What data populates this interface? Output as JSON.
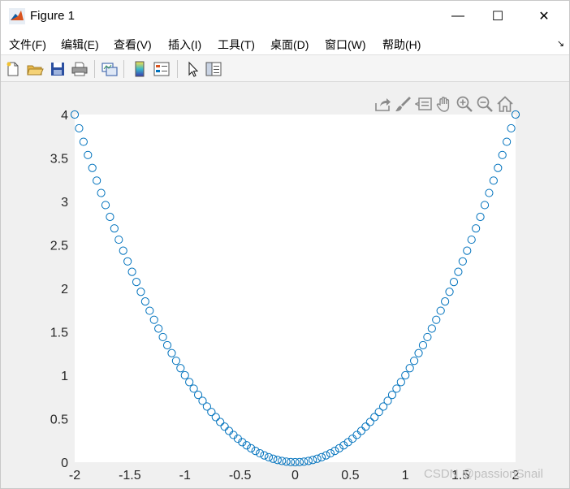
{
  "window": {
    "title": "Figure 1",
    "minimize_glyph": "—",
    "maximize_glyph": "☐",
    "close_glyph": "✕"
  },
  "menu": {
    "items": [
      {
        "label": "文件(F)"
      },
      {
        "label": "编辑(E)"
      },
      {
        "label": "查看(V)"
      },
      {
        "label": "插入(I)"
      },
      {
        "label": "工具(T)"
      },
      {
        "label": "桌面(D)"
      },
      {
        "label": "窗口(W)"
      },
      {
        "label": "帮助(H)"
      }
    ],
    "overflow_glyph": "↘"
  },
  "toolbar": {
    "icons": [
      "new-file-icon",
      "open-folder-icon",
      "save-icon",
      "print-icon",
      "link-plot-icon",
      "colorbar-icon",
      "legend-icon",
      "pointer-icon",
      "property-editor-icon"
    ]
  },
  "axes_toolbar": {
    "icons": [
      "export-icon",
      "brush-icon",
      "data-tips-icon",
      "pan-icon",
      "zoom-in-icon",
      "zoom-out-icon",
      "home-icon"
    ]
  },
  "watermark": "CSDN @passionSnail",
  "colors": {
    "marker": "#0072bd",
    "axes_bg": "#ffffff",
    "figure_bg": "#f0f0f0"
  },
  "chart_data": {
    "type": "scatter",
    "marker": "circle-open",
    "xlim": [
      -2,
      2
    ],
    "ylim": [
      0,
      4
    ],
    "x_ticks": [
      -2,
      -1.5,
      -1,
      -0.5,
      0,
      0.5,
      1,
      1.5,
      2
    ],
    "x_tick_labels": [
      "-2",
      "-1.5",
      "-1",
      "-0.5",
      "0",
      "0.5",
      "1",
      "1.5",
      "2"
    ],
    "y_ticks": [
      0,
      0.5,
      1,
      1.5,
      2,
      2.5,
      3,
      3.5,
      4
    ],
    "y_tick_labels": [
      "0",
      "0.5",
      "1",
      "1.5",
      "2",
      "2.5",
      "3",
      "3.5",
      "4"
    ],
    "series": [
      {
        "x": [
          -2,
          -1.96,
          -1.92,
          -1.88,
          -1.84,
          -1.8,
          -1.76,
          -1.72,
          -1.68,
          -1.64,
          -1.6,
          -1.56,
          -1.52,
          -1.48,
          -1.44,
          -1.4,
          -1.36,
          -1.32,
          -1.28,
          -1.24,
          -1.2,
          -1.16,
          -1.12,
          -1.08,
          -1.04,
          -1,
          -0.96,
          -0.92,
          -0.88,
          -0.84,
          -0.8,
          -0.76,
          -0.72,
          -0.68,
          -0.64,
          -0.6,
          -0.56,
          -0.52,
          -0.48,
          -0.44,
          -0.4,
          -0.36,
          -0.32,
          -0.28,
          -0.24,
          -0.2,
          -0.16,
          -0.12,
          -0.08,
          -0.04,
          0,
          0.04,
          0.08,
          0.12,
          0.16,
          0.2,
          0.24,
          0.28,
          0.32,
          0.36,
          0.4,
          0.44,
          0.48,
          0.52,
          0.56,
          0.6,
          0.64,
          0.68,
          0.72,
          0.76,
          0.8,
          0.84,
          0.88,
          0.92,
          0.96,
          1,
          1.04,
          1.08,
          1.12,
          1.16,
          1.2,
          1.24,
          1.28,
          1.32,
          1.36,
          1.4,
          1.44,
          1.48,
          1.52,
          1.56,
          1.6,
          1.64,
          1.68,
          1.72,
          1.76,
          1.8,
          1.84,
          1.88,
          1.92,
          1.96,
          2
        ],
        "y": [
          4,
          3.8416,
          3.6864,
          3.5344,
          3.3856,
          3.24,
          3.0976,
          2.9584,
          2.8224,
          2.6896,
          2.56,
          2.4336,
          2.3104,
          2.1904,
          2.0736,
          1.96,
          1.8496,
          1.7424,
          1.6384,
          1.5376,
          1.44,
          1.3456,
          1.2544,
          1.1664,
          1.0816,
          1,
          0.9216,
          0.8464,
          0.7744,
          0.7056,
          0.64,
          0.5776,
          0.5184,
          0.4624,
          0.4096,
          0.36,
          0.3136,
          0.2704,
          0.2304,
          0.1936,
          0.16,
          0.1296,
          0.1024,
          0.0784,
          0.0576,
          0.04,
          0.0256,
          0.0144,
          0.0064,
          0.0016,
          0,
          0.0016,
          0.0064,
          0.0144,
          0.0256,
          0.04,
          0.0576,
          0.0784,
          0.1024,
          0.1296,
          0.16,
          0.1936,
          0.2304,
          0.2704,
          0.3136,
          0.36,
          0.4096,
          0.4624,
          0.5184,
          0.5776,
          0.64,
          0.7056,
          0.7744,
          0.8464,
          0.9216,
          1,
          1.0816,
          1.1664,
          1.2544,
          1.3456,
          1.44,
          1.5376,
          1.6384,
          1.7424,
          1.8496,
          1.96,
          2.0736,
          2.1904,
          2.3104,
          2.4336,
          2.56,
          2.6896,
          2.8224,
          2.9584,
          3.0976,
          3.24,
          3.3856,
          3.5344,
          3.6864,
          3.8416,
          4
        ]
      }
    ]
  }
}
